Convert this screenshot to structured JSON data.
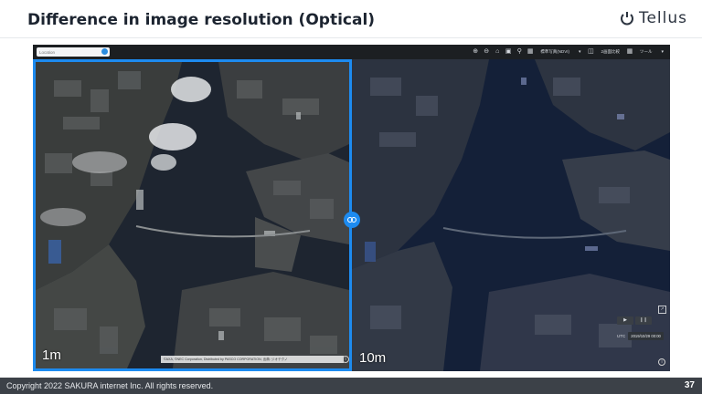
{
  "slide": {
    "title": "Difference in image resolution (Optical)",
    "logo_text": "Tellus",
    "footer": "Copyright 2022 SAKURA internet Inc. All rights reserved.",
    "page_number": "37"
  },
  "map": {
    "search": {
      "placeholder": "Location"
    },
    "toolbar": {
      "icons": [
        "zoom-in-icon",
        "zoom-out-icon",
        "home-icon",
        "map-book-icon",
        "pin-icon",
        "grid-icon"
      ],
      "basemap_select": "標準写真(NDVI)",
      "basemap_caret": "▾",
      "compare_label": "2画面比較",
      "tool_label": "ツール",
      "tool_caret": "▾"
    },
    "left_pane": {
      "resolution": "1m",
      "attribution": "©AXA, ©NEC Corporation, Distributed by PASCO CORPORATION, 出典: ジオテクノ"
    },
    "right_pane": {
      "resolution": "10m"
    },
    "time_controls": {
      "play": "▶",
      "pause": "❙❙",
      "utc_label": "UTC",
      "utc_value": "2019/10/29 00:00"
    },
    "colors": {
      "accent": "#1d8bf0",
      "water_left": "#1e2530",
      "water_right": "#142038"
    }
  }
}
